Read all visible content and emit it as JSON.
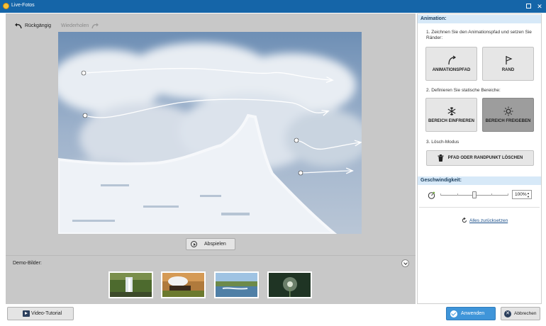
{
  "window": {
    "title": "Live-Fotos"
  },
  "toolbar": {
    "undo_label": "Rückgängig",
    "redo_label": "Wiederholen"
  },
  "canvas": {
    "play_label": "Abspielen"
  },
  "demo": {
    "label": "Demo-Bilder:",
    "thumbnails": [
      "waterfall",
      "steam-locomotive",
      "river-rapids",
      "dandelion"
    ]
  },
  "panel": {
    "animation_header": "Animation:",
    "step1": "1. Zeichnen Sie den Animationspfad und setzen Sie Ränder:",
    "path_button": "ANIMATIONSPFAD",
    "edge_button": "RAND",
    "step2": "2. Definieren Sie statische Bereiche:",
    "freeze_button": "BEREICH EINFRIEREN",
    "unfreeze_button": "BEREICH FREIGEBEN",
    "step3": "3. Lösch-Modus",
    "delete_button": "PFAD ODER RANDPUNKT LÖSCHEN",
    "speed_header": "Geschwindigkeit:",
    "speed_value": "100%",
    "speed_level_percent": 50,
    "reset_label": "Alles zurücksetzen"
  },
  "footer": {
    "tutorial_label": "Video-Tutorial",
    "apply_label": "Anwenden",
    "cancel_label": "Abbrechen"
  },
  "colors": {
    "titlebar": "#1565a8",
    "section_header": "#d7e9f8",
    "apply": "#3f95d9",
    "active_button": "#9d9d9d"
  }
}
